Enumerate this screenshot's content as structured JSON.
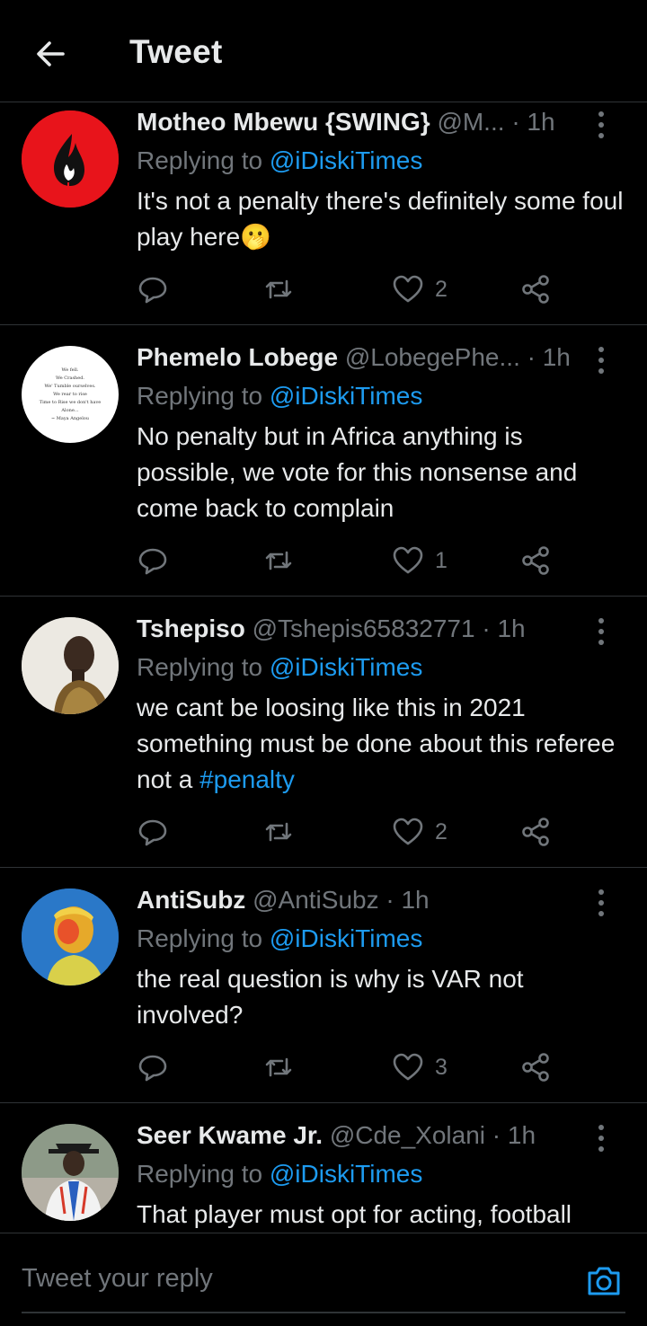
{
  "header": {
    "title": "Tweet",
    "back_icon": "arrow-left-icon"
  },
  "tweets": [
    {
      "name": "Motheo Mbewu {SWING}",
      "handle": "@M...",
      "time": "1h",
      "replying_prefix": "Replying to",
      "replying_to": "@iDiskiTimes",
      "text": "It's not a penalty there's definitely some foul play here",
      "emoji": "🫢",
      "likes": "2",
      "retweets": "",
      "replies": ""
    },
    {
      "name": "Phemelo Lobege",
      "handle": "@LobegePhe...",
      "time": "1h",
      "replying_prefix": "Replying to",
      "replying_to": "@iDiskiTimes",
      "text": "No penalty but in Africa anything is possible, we vote for this nonsense and come back to complain",
      "likes": "1"
    },
    {
      "name": "Tshepiso",
      "handle": "@Tshepis65832771",
      "time": "1h",
      "replying_prefix": "Replying to",
      "replying_to": "@iDiskiTimes",
      "text": "we cant be loosing like this in 2021 something must be done about this referee not a ",
      "hashtag": "#penalty",
      "likes": "2"
    },
    {
      "name": "AntiSubz",
      "handle": "@AntiSubz",
      "time": "1h",
      "replying_prefix": "Replying to",
      "replying_to": "@iDiskiTimes",
      "text": "the real question is why is VAR not involved?",
      "likes": "3"
    },
    {
      "name": "Seer Kwame Jr.",
      "handle": "@Cde_Xolani",
      "time": "1h",
      "replying_prefix": "Replying to",
      "replying_to": "@iDiskiTimes",
      "text": "That player must opt for acting, football"
    }
  ],
  "avatar_quote": [
    "We fell.",
    "We Crashed.",
    "We' Tumble ourselves.",
    "We rear to rise",
    "Time to Rise we don't have",
    "Alone...",
    "~ Maya Angelou"
  ],
  "composer": {
    "placeholder": "Tweet your reply",
    "camera_icon": "camera-icon"
  },
  "colors": {
    "background": "#000000",
    "text": "#e7e9ea",
    "muted": "#71767b",
    "accent": "#1d9bf0",
    "divider": "#2f3336"
  },
  "separator": "·"
}
